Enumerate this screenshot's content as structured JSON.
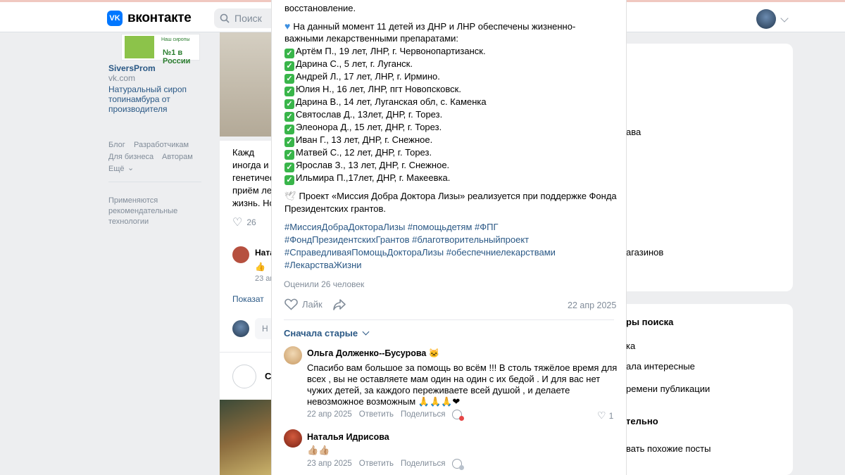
{
  "header": {
    "logo_text": "вконтакте",
    "logo_mark": "VK",
    "search_placeholder": "Поиск"
  },
  "left_ad": {
    "badge_small": "Наш сиропы",
    "badge_big": "№1 в России",
    "brand": "SiversProm",
    "url": "vk.com",
    "description": [
      "Натуральный сироп",
      "топинамбура от",
      "производителя"
    ]
  },
  "left_links": {
    "row1": [
      "Блог",
      "Разработчикам"
    ],
    "row2": [
      "Для бизнеса",
      "Авторам"
    ],
    "more": "Ещё"
  },
  "left_reco": [
    "Применяются",
    "рекомендательные",
    "технологии"
  ],
  "feed_bg": {
    "lines": [
      "Кажд",
      "иногда и н",
      "генетичес",
      "приём лек",
      "жизнь. Но"
    ],
    "likes": "26",
    "commenter": "Натал",
    "date": "23 апр",
    "show_more": "Показат",
    "comment_placeholder": "Н",
    "group_initial": "С"
  },
  "right_bg": {
    "a": "ава",
    "b": "агазинов",
    "c": "ры поиска",
    "d": "ка",
    "e": "ала интересные",
    "f": "ремени публикации",
    "g": "тельно",
    "h": "вать похожие посты"
  },
  "post": {
    "intro": "восстановление.",
    "summary_line1": "На данный момент 11 детей из ДНР и ЛНР обеспечены жизненно-",
    "summary_line2": "важными лекарственными препаратами:",
    "children": [
      "Артём П., 19 лет, ЛНР, г. Червонопартизанск.",
      "Дарина С., 5 лет, г. Луганск.",
      "Андрей Л., 17 лет, ЛНР, г. Ирмино.",
      "Юлия Н., 16 лет, ЛНР, пгт Новопсковск.",
      "Дарина В., 14 лет, Луганская обл, с. Каменка",
      "Святослав Д., 13лет, ДНР, г. Торез.",
      "Элеонора Д., 15 лет, ДНР, г. Торез.",
      "Иван Г., 13 лет, ДНР, г. Снежное.",
      "Матвей С., 12 лет, ДНР, г. Торез.",
      "Ярослав З., 13 лет, ДНР, г. Снежное.",
      "Ильмира П.,17лет, ДНР, г. Макеевка."
    ],
    "project_line1": "Проект «Миссия Добра Доктора Лизы» реализуется при поддержке Фонда",
    "project_line2": "Президентских грантов.",
    "hashtags": [
      "#МиссияДобраДоктораЛизы #помощьдетям #ФПГ",
      "#ФондПрезидентскихГрантов #благотворительныйпроект",
      "#СправедливаяПомощьДоктораЛизы #обеспечниелекарствами",
      "#ЛекарстваЖизни"
    ],
    "rated": "Оценили 26 человек",
    "like_label": "Лайк",
    "date": "22 апр 2025"
  },
  "comments": {
    "sort_label": "Сначала старые",
    "items": [
      {
        "author": "Ольга Долженко--Бусурова 🐱",
        "lines": [
          "Спасибо вам большое за помощь во всём !!! В столь тяжёлое время для",
          "всех , вы не оставляете мам один на один с их бедой . И для вас нет",
          "чужих детей, за каждого переживаете всей душой , и делаете",
          "невозможное возможным 🙏🙏🙏❤"
        ],
        "date": "22 апр 2025",
        "reply": "Ответить",
        "share": "Поделиться",
        "likes": "1"
      },
      {
        "author": "Наталья Идрисова",
        "lines": [
          "👍🏼👍🏼"
        ],
        "date": "23 апр 2025",
        "reply": "Ответить",
        "share": "Поделиться"
      }
    ]
  },
  "colors": {
    "accent": "#0077ff",
    "link": "#2a5885",
    "check": "#39b54a",
    "muted": "#818c99"
  }
}
